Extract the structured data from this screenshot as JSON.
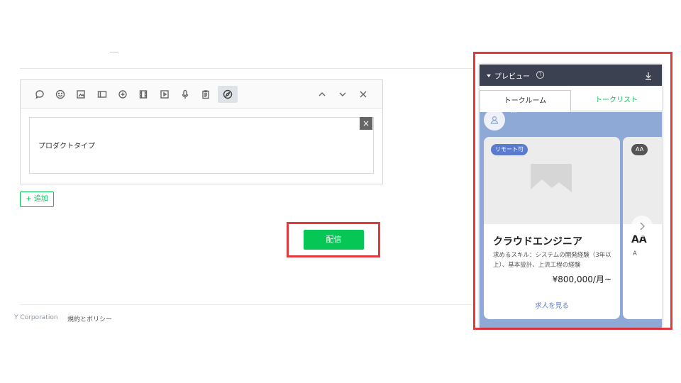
{
  "editor": {
    "content_text": "プロダクトタイプ",
    "close_glyph": "×",
    "toolbar_icons": [
      "speech-bubble-icon",
      "emoji-icon",
      "image-icon",
      "card-icon",
      "chat-plus-icon",
      "video-icon",
      "play-icon",
      "mic-icon",
      "clipboard-icon",
      "compass-icon",
      "chevron-up-icon",
      "chevron-down-icon",
      "close-icon"
    ]
  },
  "actions": {
    "add_label": "+ 追加",
    "send_label": "配信"
  },
  "footer": {
    "copyright": "Y Corporation",
    "policy_link": "規約とポリシー"
  },
  "preview": {
    "title": "プレビュー",
    "help_glyph": "?",
    "tabs": [
      {
        "label": "トークルーム"
      },
      {
        "label": "トークリスト"
      }
    ],
    "sender_name": "...",
    "cards": [
      {
        "badge": "リモート可",
        "title": "クラウドエンジニア",
        "description": "求めるスキル：システムの開発経験（3年以上）、基本設計、上流工程の経験",
        "price": "¥800,000/月~",
        "action": "求人を見る"
      },
      {
        "badge": "AA",
        "title": "AA",
        "description": "A"
      }
    ]
  },
  "colors": {
    "accent_green": "#06c755",
    "highlight_red": "#e0393e",
    "preview_header": "#3b4150",
    "chat_bg": "#8fa9d6",
    "link_blue": "#5b7bcf"
  }
}
